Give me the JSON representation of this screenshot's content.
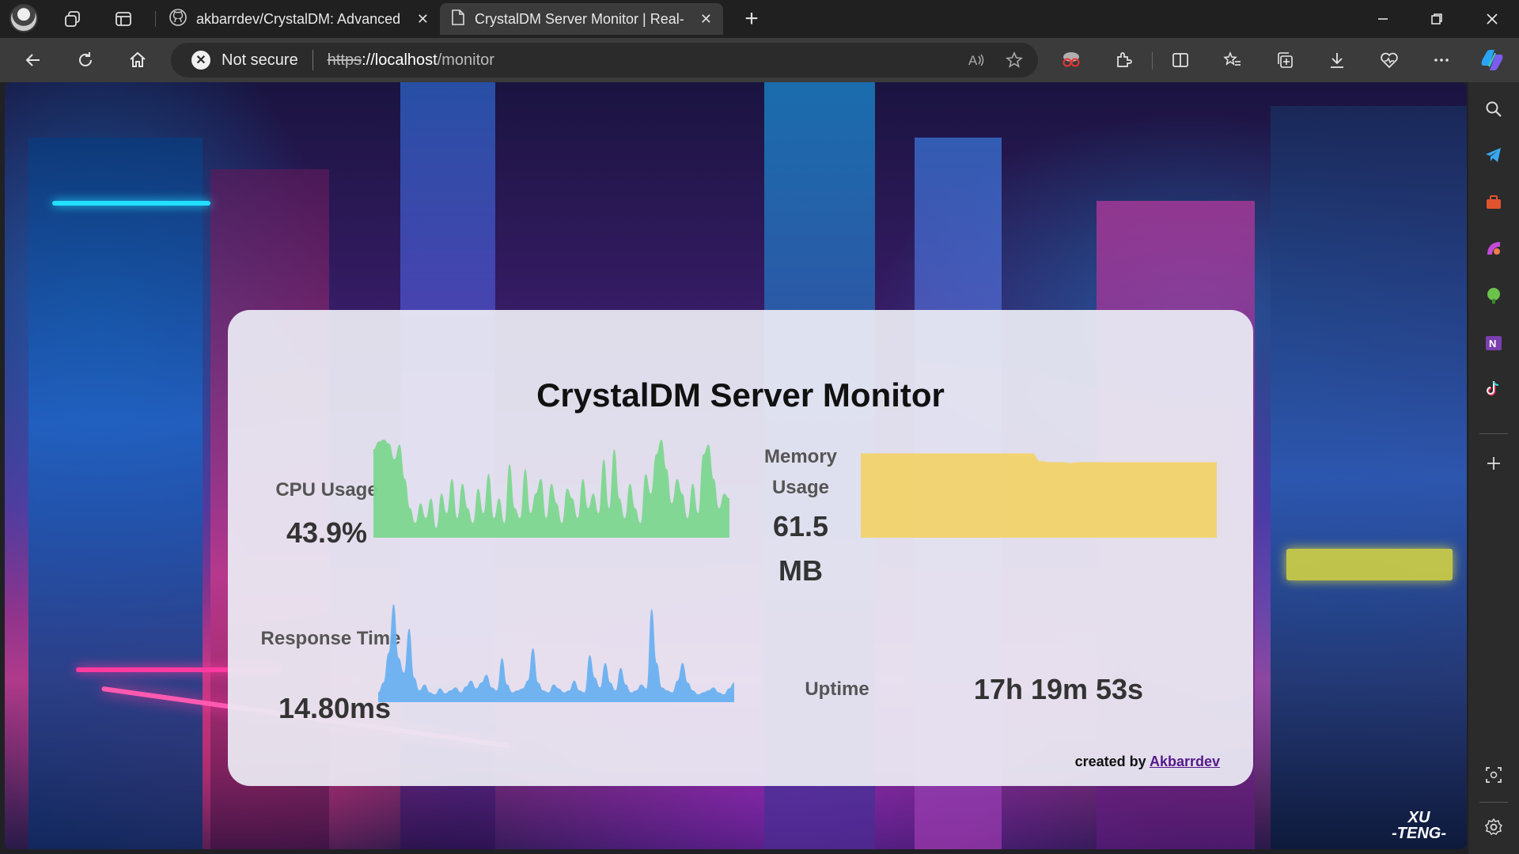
{
  "browser": {
    "tabs": [
      {
        "title": "akbarrdev/CrystalDM: Advanced",
        "icon": "github-icon",
        "active": false
      },
      {
        "title": "CrystalDM Server Monitor | Real-",
        "icon": "page-icon",
        "active": true
      }
    ],
    "address": {
      "security_label": "Not secure",
      "url_scheme": "https",
      "url_host": "://localhost",
      "url_path": "/monitor"
    }
  },
  "monitor": {
    "title": "CrystalDM Server Monitor",
    "cpu": {
      "label": "CPU Usage",
      "value": "43.9%",
      "color": "#7dd68f",
      "history": [
        90,
        98,
        100,
        96,
        80,
        95,
        60,
        30,
        15,
        35,
        20,
        40,
        10,
        45,
        25,
        60,
        20,
        55,
        30,
        15,
        50,
        25,
        65,
        20,
        40,
        15,
        75,
        30,
        20,
        70,
        25,
        45,
        60,
        20,
        55,
        35,
        15,
        50,
        40,
        20,
        60,
        30,
        45,
        25,
        80,
        30,
        90,
        40,
        20,
        55,
        30,
        15,
        65,
        45,
        85,
        100,
        70,
        35,
        60,
        45,
        20,
        55,
        25,
        85,
        95,
        60,
        30,
        45,
        40
      ]
    },
    "memory": {
      "label": "Memory Usage",
      "value": "61.5 MB",
      "value_line1": "61.5",
      "value_line2": "MB",
      "color": "#f2d26c",
      "history": [
        86,
        86,
        86,
        86,
        86,
        86,
        86,
        86,
        86,
        86,
        86,
        86,
        86,
        86,
        86,
        86,
        86,
        86,
        86,
        86,
        86,
        86,
        86,
        86,
        86,
        86,
        86,
        86,
        86,
        86,
        86,
        86,
        86,
        86,
        78,
        78,
        77,
        77,
        77,
        77,
        76,
        77,
        77,
        77,
        77,
        77,
        77,
        77,
        77,
        77,
        77,
        77,
        77,
        77,
        77,
        77,
        77,
        77,
        77,
        77,
        77,
        77,
        77,
        77,
        77,
        77,
        77,
        77,
        77
      ]
    },
    "response": {
      "label": "Response Time",
      "value": "14.80ms",
      "color": "#6ab0f0",
      "history": [
        10,
        20,
        50,
        100,
        45,
        30,
        75,
        25,
        12,
        18,
        10,
        8,
        14,
        9,
        12,
        15,
        10,
        16,
        22,
        14,
        20,
        28,
        15,
        12,
        45,
        18,
        10,
        12,
        14,
        22,
        55,
        20,
        12,
        10,
        18,
        14,
        10,
        12,
        22,
        12,
        10,
        48,
        25,
        15,
        40,
        20,
        12,
        35,
        18,
        10,
        12,
        18,
        14,
        95,
        40,
        15,
        12,
        10,
        22,
        40,
        20,
        12,
        8,
        10,
        12,
        15,
        10,
        8,
        14,
        20
      ]
    },
    "uptime": {
      "label": "Uptime",
      "value": "17h 19m 53s"
    },
    "credit": {
      "prefix": "created by",
      "author": "Akbarrdev"
    }
  }
}
